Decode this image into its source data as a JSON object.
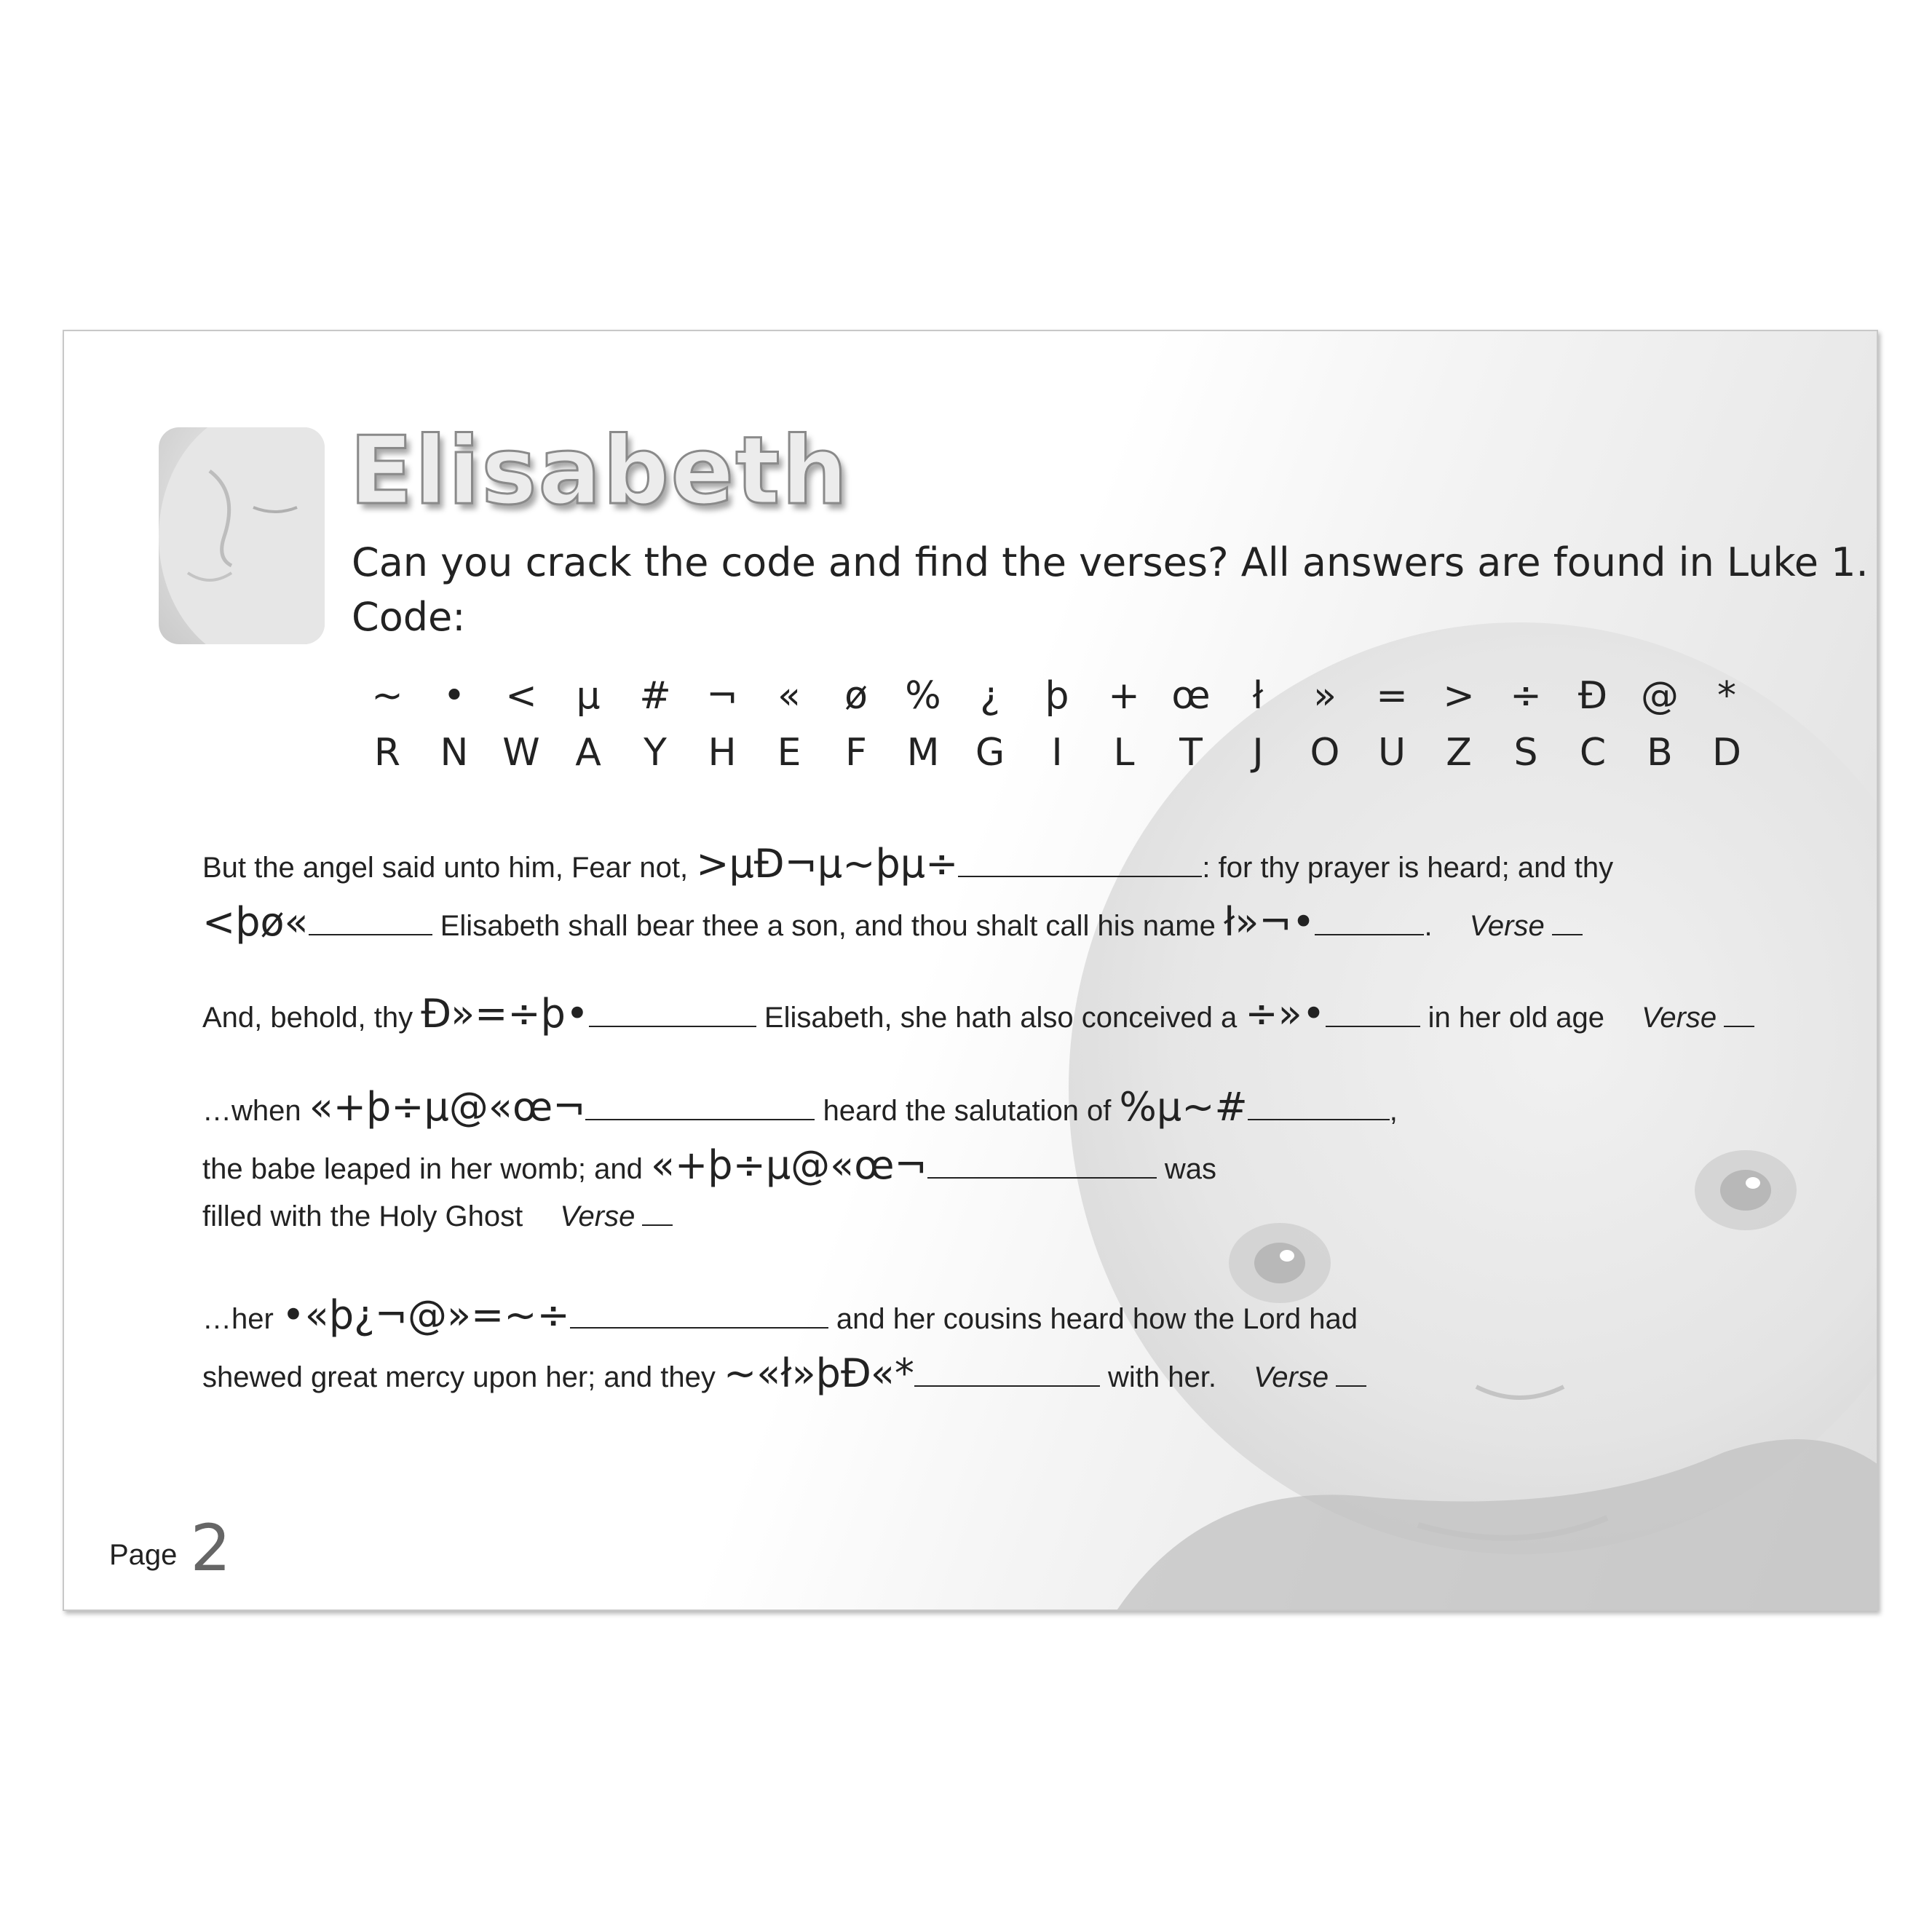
{
  "title": "Elisabeth",
  "intro": {
    "line1": "Can you crack the code and find the verses? All answers are found in Luke 1.",
    "line2": "Code:"
  },
  "code": [
    {
      "symbol": "~",
      "letter": "R"
    },
    {
      "symbol": "•",
      "letter": "N"
    },
    {
      "symbol": "<",
      "letter": "W"
    },
    {
      "symbol": "µ",
      "letter": "A"
    },
    {
      "symbol": "#",
      "letter": "Y"
    },
    {
      "symbol": "¬",
      "letter": "H"
    },
    {
      "symbol": "«",
      "letter": "E"
    },
    {
      "symbol": "ø",
      "letter": "F"
    },
    {
      "symbol": "%",
      "letter": "M"
    },
    {
      "symbol": "¿",
      "letter": "G"
    },
    {
      "symbol": "þ",
      "letter": "I"
    },
    {
      "symbol": "+",
      "letter": "L"
    },
    {
      "symbol": "œ",
      "letter": "T"
    },
    {
      "symbol": "ł",
      "letter": "J"
    },
    {
      "symbol": "»",
      "letter": "O"
    },
    {
      "symbol": "=",
      "letter": "U"
    },
    {
      "symbol": ">",
      "letter": "Z"
    },
    {
      "symbol": "÷",
      "letter": "S"
    },
    {
      "symbol": "Ð",
      "letter": "C"
    },
    {
      "symbol": "@",
      "letter": "B"
    },
    {
      "symbol": "*",
      "letter": "D"
    }
  ],
  "verses": {
    "v1": {
      "t1": "But the angel said unto him, Fear not,",
      "c1": ">µÐ¬µ~þµ÷",
      "t2": ": for thy prayer is heard; and thy",
      "c2": "<þø«",
      "t3": "Elisabeth shall bear thee a son, and thou shalt call his name",
      "c3": "ł»¬•",
      "t4": ".",
      "ref": "Verse"
    },
    "v2": {
      "t1": "And, behold, thy",
      "c1": "Ð»=÷þ•",
      "t2": "Elisabeth, she hath also conceived a",
      "c2": "÷»•",
      "t3": "in her old age",
      "ref": "Verse"
    },
    "v3": {
      "t1": "…when",
      "c1": "«+þ÷µ@«œ¬",
      "t2": "heard the salutation of",
      "c2": "%µ~#",
      "t3": ",",
      "t4": "the babe leaped in her womb; and",
      "c3": "«+þ÷µ@«œ¬",
      "t5": "was",
      "t6": "filled with the Holy Ghost",
      "ref": "Verse"
    },
    "v4": {
      "t1": "…her",
      "c1": "•«þ¿¬@»=~÷",
      "t2": "and her cousins heard how the Lord had",
      "t3": "shewed great mercy upon her; and they",
      "c2": "~«ł»þÐ«*",
      "t4": "with her.",
      "ref": "Verse"
    }
  },
  "page": {
    "label": "Page",
    "number": "2"
  }
}
